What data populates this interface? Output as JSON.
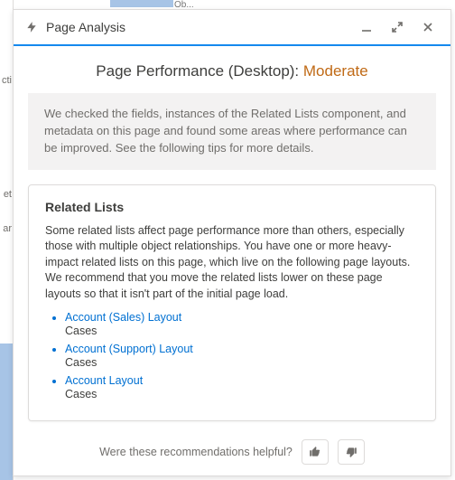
{
  "bg": {
    "label": "Ob..."
  },
  "header": {
    "title": "Page Analysis"
  },
  "main": {
    "perf_prefix": "Page Performance (Desktop): ",
    "perf_rating": "Moderate",
    "summary": "We checked the fields, instances of the Related Lists component, and metadata on this page and found some areas where performance can be improved. See the following tips for more details."
  },
  "card": {
    "title": "Related Lists",
    "desc": "Some related lists affect page performance more than others, especially those with multiple object relationships. You have one or more heavy-impact related lists on this page, which live on the following page layouts. We recommend that you move the related lists lower on these page layouts so that it isn't part of the initial page load.",
    "items": [
      {
        "link": "Account (Sales) Layout",
        "sub": "Cases"
      },
      {
        "link": "Account (Support) Layout",
        "sub": "Cases"
      },
      {
        "link": "Account Layout",
        "sub": "Cases"
      }
    ]
  },
  "footer": {
    "question": "Were these recommendations helpful?"
  }
}
